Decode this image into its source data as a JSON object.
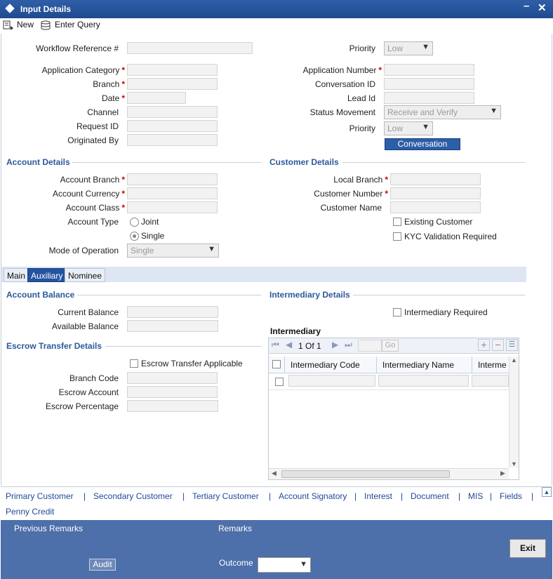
{
  "window": {
    "title": "Input Details"
  },
  "toolbar": {
    "new_label": "New",
    "enter_query_label": "Enter Query"
  },
  "header": {
    "workflow_ref_label": "Workflow Reference #",
    "priority_label": "Priority",
    "priority_value": "Low",
    "application_category_label": "Application Category",
    "branch_label": "Branch",
    "date_label": "Date",
    "channel_label": "Channel",
    "request_id_label": "Request ID",
    "originated_by_label": "Originated By",
    "application_number_label": "Application Number",
    "conversation_id_label": "Conversation ID",
    "lead_id_label": "Lead Id",
    "status_movement_label": "Status Movement",
    "status_movement_value": "Receive and Verify",
    "priority2_label": "Priority",
    "priority2_value": "Low",
    "conversation_button": "Conversation"
  },
  "account_details": {
    "title": "Account Details",
    "account_branch_label": "Account Branch",
    "account_currency_label": "Account Currency",
    "account_class_label": "Account Class",
    "account_type_label": "Account Type",
    "joint_label": "Joint",
    "single_label": "Single",
    "mode_label": "Mode of Operation",
    "mode_value": "Single"
  },
  "customer_details": {
    "title": "Customer Details",
    "local_branch_label": "Local Branch",
    "customer_number_label": "Customer Number",
    "customer_name_label": "Customer Name",
    "existing_customer_label": "Existing Customer",
    "kyc_label": "KYC Validation Required"
  },
  "tabs": [
    {
      "label": "Main"
    },
    {
      "label": "Auxiliary"
    },
    {
      "label": "Nominee"
    }
  ],
  "account_balance": {
    "title": "Account Balance",
    "current_label": "Current Balance",
    "available_label": "Available Balance"
  },
  "escrow": {
    "title": "Escrow Transfer Details",
    "applicable_label": "Escrow Transfer Applicable",
    "branch_code_label": "Branch Code",
    "escrow_account_label": "Escrow Account",
    "escrow_percentage_label": "Escrow Percentage"
  },
  "intermediary": {
    "title": "Intermediary Details",
    "required_label": "Intermediary Required",
    "grid_title": "Intermediary",
    "pager": "1 Of 1",
    "go_label": "Go",
    "columns": [
      "Intermediary Code",
      "Intermediary Name",
      "Interme"
    ]
  },
  "bottom_links": [
    "Primary Customer",
    "Secondary Customer",
    "Tertiary Customer",
    "Account Signatory",
    "Interest",
    "Document",
    "MIS",
    "Fields",
    "Penny Credit"
  ],
  "footer": {
    "previous_remarks_label": "Previous Remarks",
    "remarks_label": "Remarks",
    "audit_label": "Audit",
    "outcome_label": "Outcome",
    "exit_label": "Exit"
  }
}
